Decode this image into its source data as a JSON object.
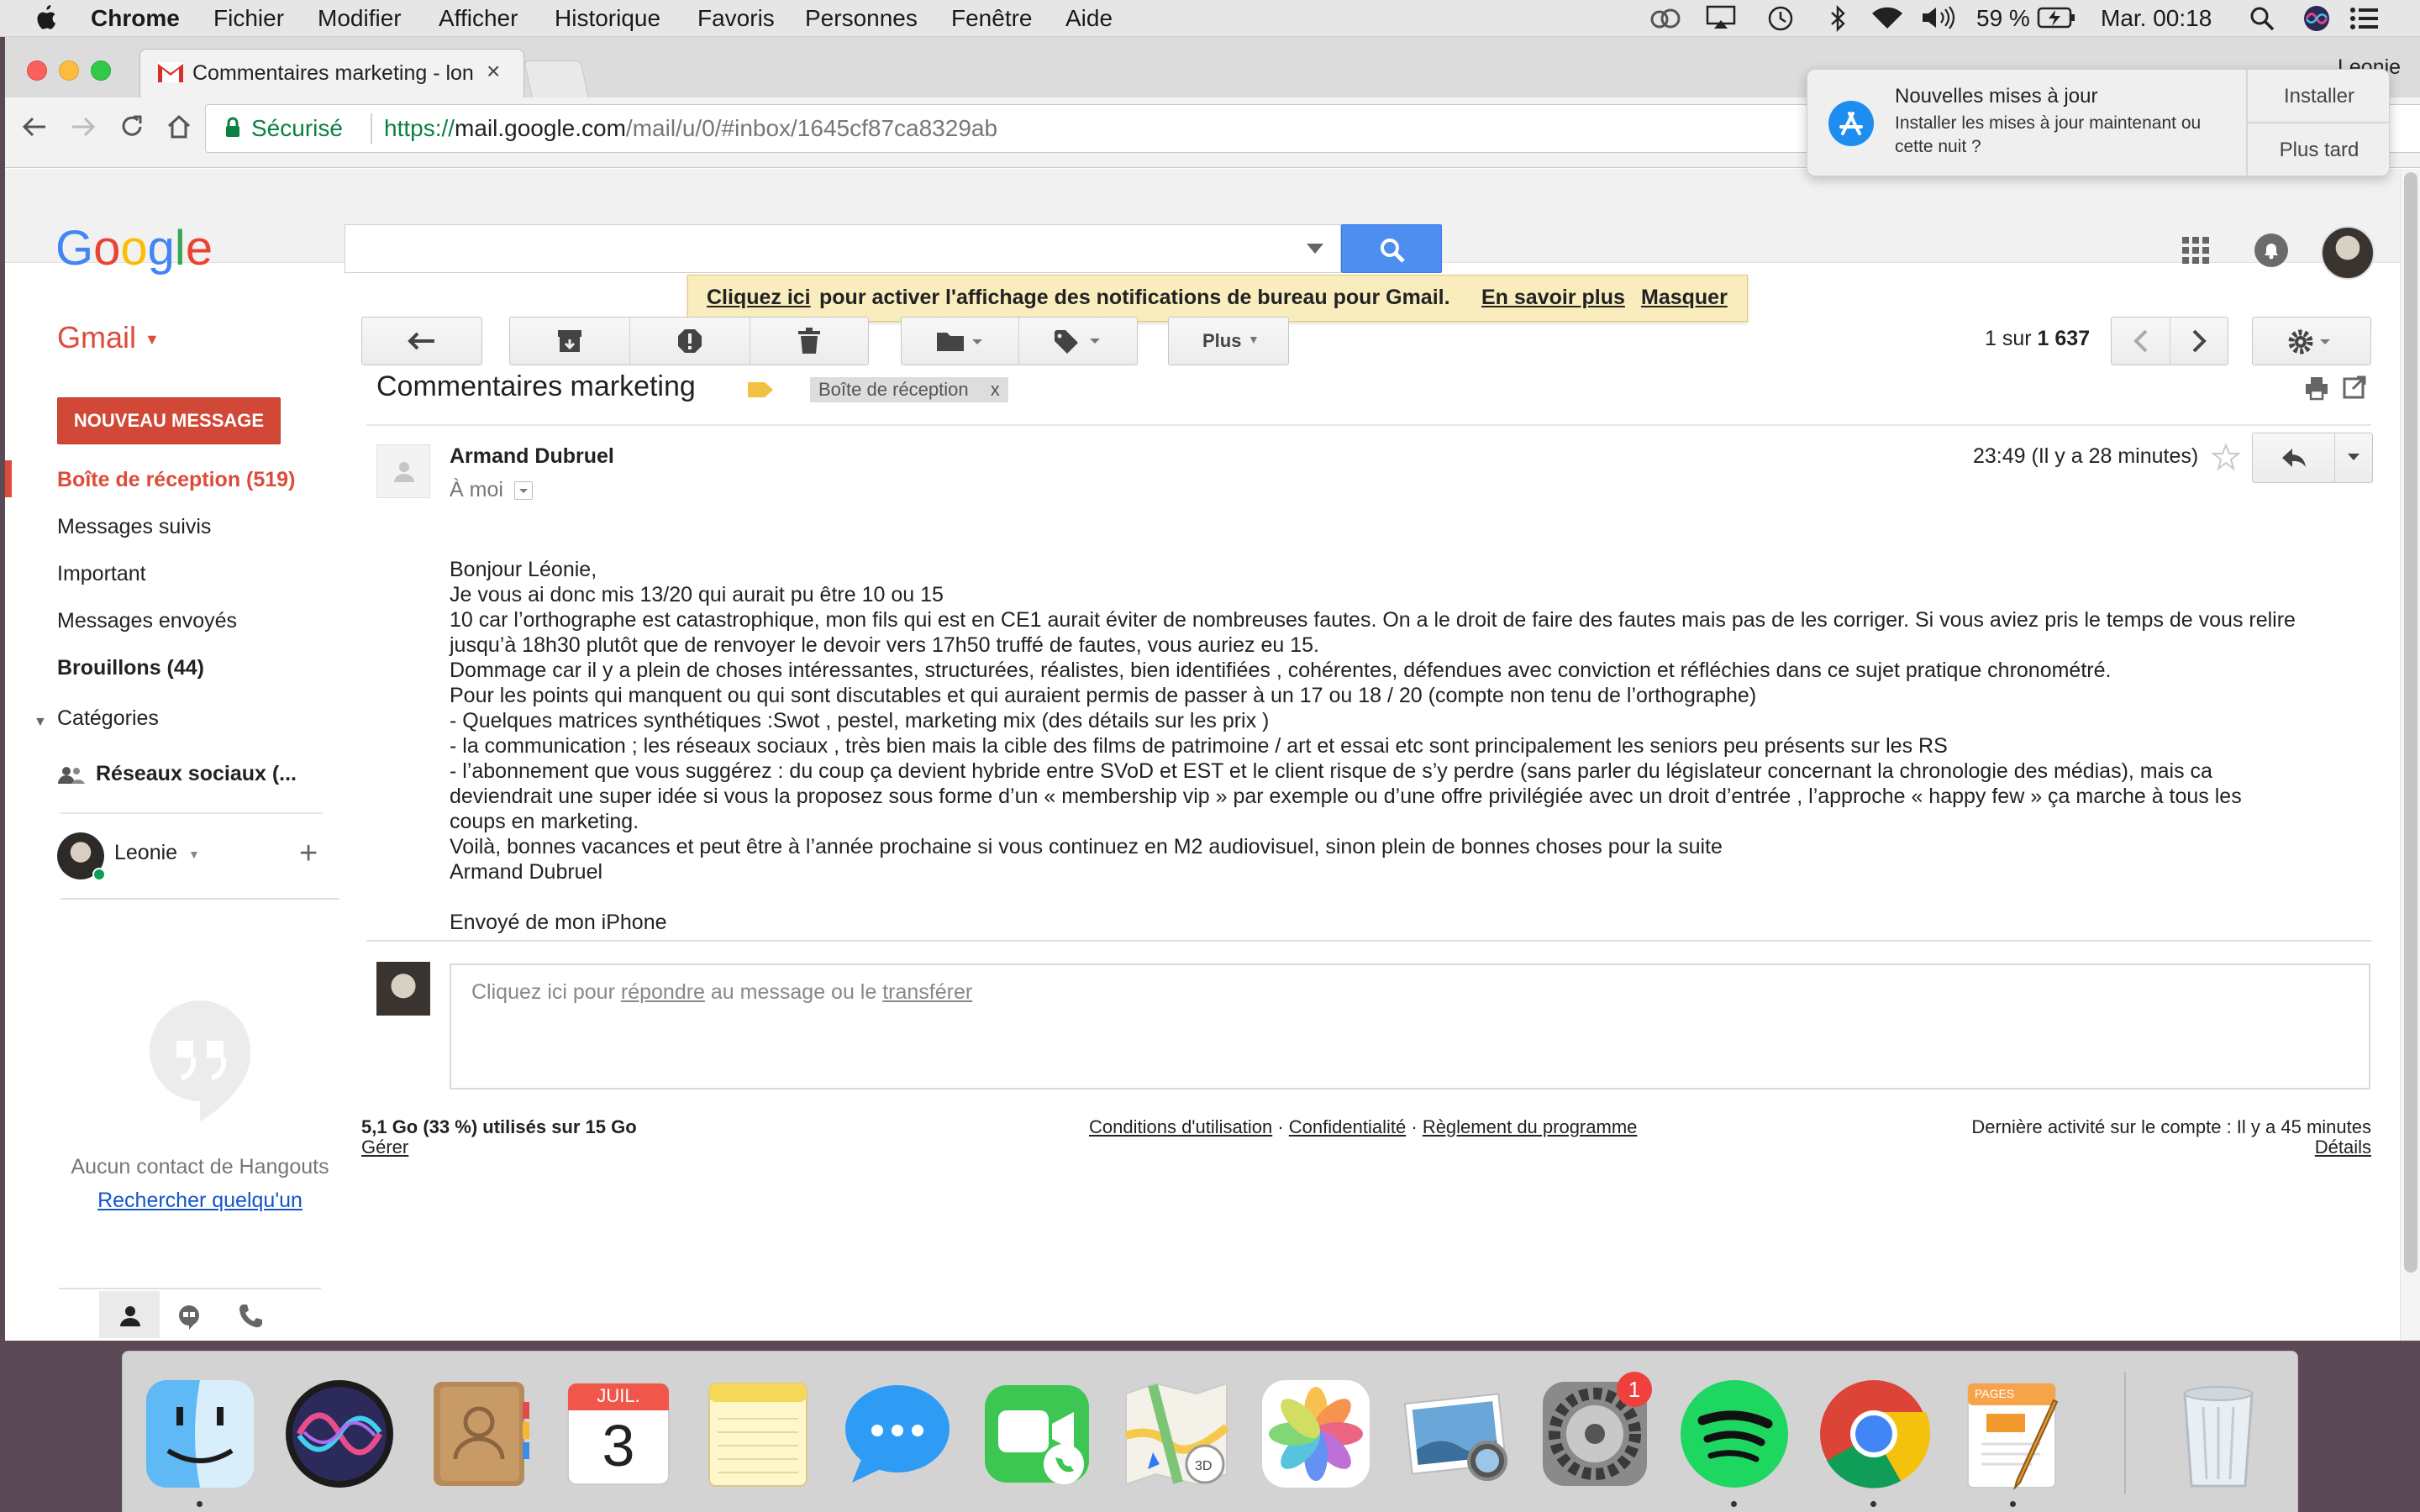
{
  "menubar": {
    "app_name": "Chrome",
    "menus": [
      "Fichier",
      "Modifier",
      "Afficher",
      "Historique",
      "Favoris",
      "Personnes",
      "Fenêtre",
      "Aide"
    ],
    "battery": "59 %",
    "clock": "Mar. 00:18"
  },
  "browser": {
    "tab_title": "Commentaires marketing - lon",
    "security_label": "Sécurisé",
    "url_prefix": "https://",
    "url_host": "mail.google.com",
    "url_path": "/mail/u/0/#inbox/1645cf87ca8329ab",
    "profile_name": "Leonie"
  },
  "notification": {
    "title": "Nouvelles mises à jour",
    "body": "Installer les mises à jour maintenant ou cette nuit ?",
    "install": "Installer",
    "later": "Plus tard"
  },
  "gmail": {
    "brand": "Gmail",
    "banner": {
      "click_here": "Cliquez ici",
      "text": "pour activer l'affichage des notifications de bureau pour Gmail.",
      "learn_more": "En savoir plus",
      "hide": "Masquer"
    },
    "more_label": "Plus",
    "pagination": {
      "prefix": "1 sur",
      "total": "1 637"
    },
    "compose": "NOUVEAU MESSAGE",
    "nav": [
      {
        "label": "Boîte de réception (519)",
        "active": true
      },
      {
        "label": "Messages suivis"
      },
      {
        "label": "Important"
      },
      {
        "label": "Messages envoyés"
      },
      {
        "label": "Brouillons (44)",
        "bold": true
      }
    ],
    "categories_label": "Catégories",
    "social_label": "Réseaux sociaux (...",
    "hangouts_user": "Leonie",
    "hangouts_empty": "Aucun contact de Hangouts",
    "hangouts_search": "Rechercher quelqu'un"
  },
  "email": {
    "subject": "Commentaires marketing",
    "label_chip": "Boîte de réception",
    "label_chip_close": "x",
    "sender": "Armand Dubruel",
    "to": "À moi",
    "time": "23:49 (Il y a 28 minutes)",
    "body_lines": [
      "Bonjour Léonie,",
      "Je vous ai donc mis 13/20 qui aurait pu être 10 ou 15",
      "10 car l’orthographe est catastrophique,  mon fils qui est en CE1 aurait éviter de nombreuses fautes. On a le droit de faire des fautes mais pas de les corriger. Si vous aviez pris le temps de vous relire",
      "jusqu’à 18h30 plutôt que de renvoyer le devoir vers 17h50 truffé de fautes, vous auriez eu 15.",
      "Dommage car il y a plein de choses intéressantes, structurées, réalistes, bien identifiées , cohérentes, défendues avec conviction et réfléchies dans ce sujet pratique chronométré.",
      "Pour les points qui manquent ou qui sont discutables et qui auraient permis de passer à un 17 ou 18 / 20 (compte non tenu de l’orthographe)",
      "- Quelques matrices synthétiques :Swot , pestel, marketing mix (des détails sur les prix )",
      "- la communication ; les réseaux sociaux , très bien mais la cible des films de patrimoine / art et essai etc sont principalement les seniors peu présents sur les RS",
      "- l’abonnement que vous suggérez : du coup ça devient hybride entre SVoD et EST et le client risque de s’y perdre (sans parler du législateur concernant la chronologie des médias), mais ca",
      "deviendrait une super idée si vous la proposez sous forme d’un « membership vip » par exemple ou d’une offre privilégiée avec un droit d’entrée , l’approche « happy few » ça marche à tous les",
      "coups en marketing.",
      "Voilà, bonnes vacances et peut être à l’année prochaine si vous continuez en M2 audiovisuel, sinon plein de bonnes choses pour la suite",
      "Armand Dubruel",
      "",
      "Envoyé de mon iPhone"
    ],
    "reply_prefix": "Cliquez ici pour",
    "reply_link": "répondre",
    "reply_mid": "au message ou le",
    "forward_link": "transférer"
  },
  "footer": {
    "storage": "5,1 Go (33 %) utilisés sur 15 Go",
    "manage": "Gérer",
    "terms": "Conditions d'utilisation",
    "privacy": "Confidentialité",
    "program": "Règlement du programme",
    "sep": "·",
    "activity": "Dernière activité sur le compte : Il y a 45 minutes",
    "details": "Détails"
  },
  "dock": {
    "calendar_month": "JUIL.",
    "calendar_day": "3",
    "prefs_badge": "1",
    "pages_label": "PAGES"
  },
  "colors": {
    "gmail_red": "#dd4b39",
    "google_blue": "#4285f4",
    "banner_bg": "#f9edbe"
  }
}
